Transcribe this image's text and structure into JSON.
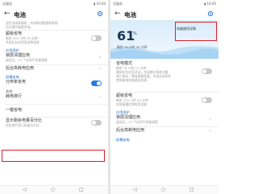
{
  "left": {
    "status": {
      "carrier": "无服务",
      "right": "▮ 10:40"
    },
    "title": "电池",
    "top_note": "设定关闭屏幕时，关闭移动数据和系统",
    "top_note2": "后以便节省更多电。",
    "s1": "超级省电",
    "power_save_sub": "剩余 220 小时 49 分钟",
    "power_save_sub2": "关闭后台应用及各种连接",
    "sec_app": "应用保护",
    "lock_clean": "锁屏清理应用",
    "lock_clean_sub": "退出后，13 个应用不会被清理",
    "bg_app": "后台高耗电应用",
    "sec_screen": "屏幕省电",
    "smart_res": "分辨率省电",
    "sec_other": "其他",
    "rank": "耗电排行",
    "onekey": "一键省电",
    "show_pct": "显示剩余电量百分比",
    "show_pct_sub": "在状态栏显示电量百分比"
  },
  "right": {
    "status": {
      "carrier": "无服务",
      "right": "▮ 10:40"
    },
    "title": "电池",
    "percent": "61",
    "percent_sign": "%",
    "remaining": "剩余 76 小时 35 分钟",
    "detail": "电量使用详情",
    "mode_title": "省电模式",
    "mode_sub": "剩余 76 小时 21 分钟",
    "mode_sub2": "限制后台应用活动，关闭部分系统功能",
    "mode_sub3": "减少振动，降低屏幕亮度，关闭自动同步",
    "mode_sub4": "使用新电池前建议充满",
    "ultra": "超级省电",
    "ultra_sub": "剩余 220 小时 49 分钟",
    "ultra_sub2": "仅保留通话和短信功能",
    "sec_app": "应用保护",
    "lock_clean": "锁屏清理应用",
    "lock_clean_sub": "退出后，13 个应用不会被清理",
    "bg_app": "后台高耗电应用",
    "sec_screen": "屏幕省电"
  },
  "nav": {
    "back": "◁",
    "home": "○",
    "recent": "□"
  },
  "colors": {
    "accent": "#2a7be4",
    "highlight": "#d9222a"
  }
}
